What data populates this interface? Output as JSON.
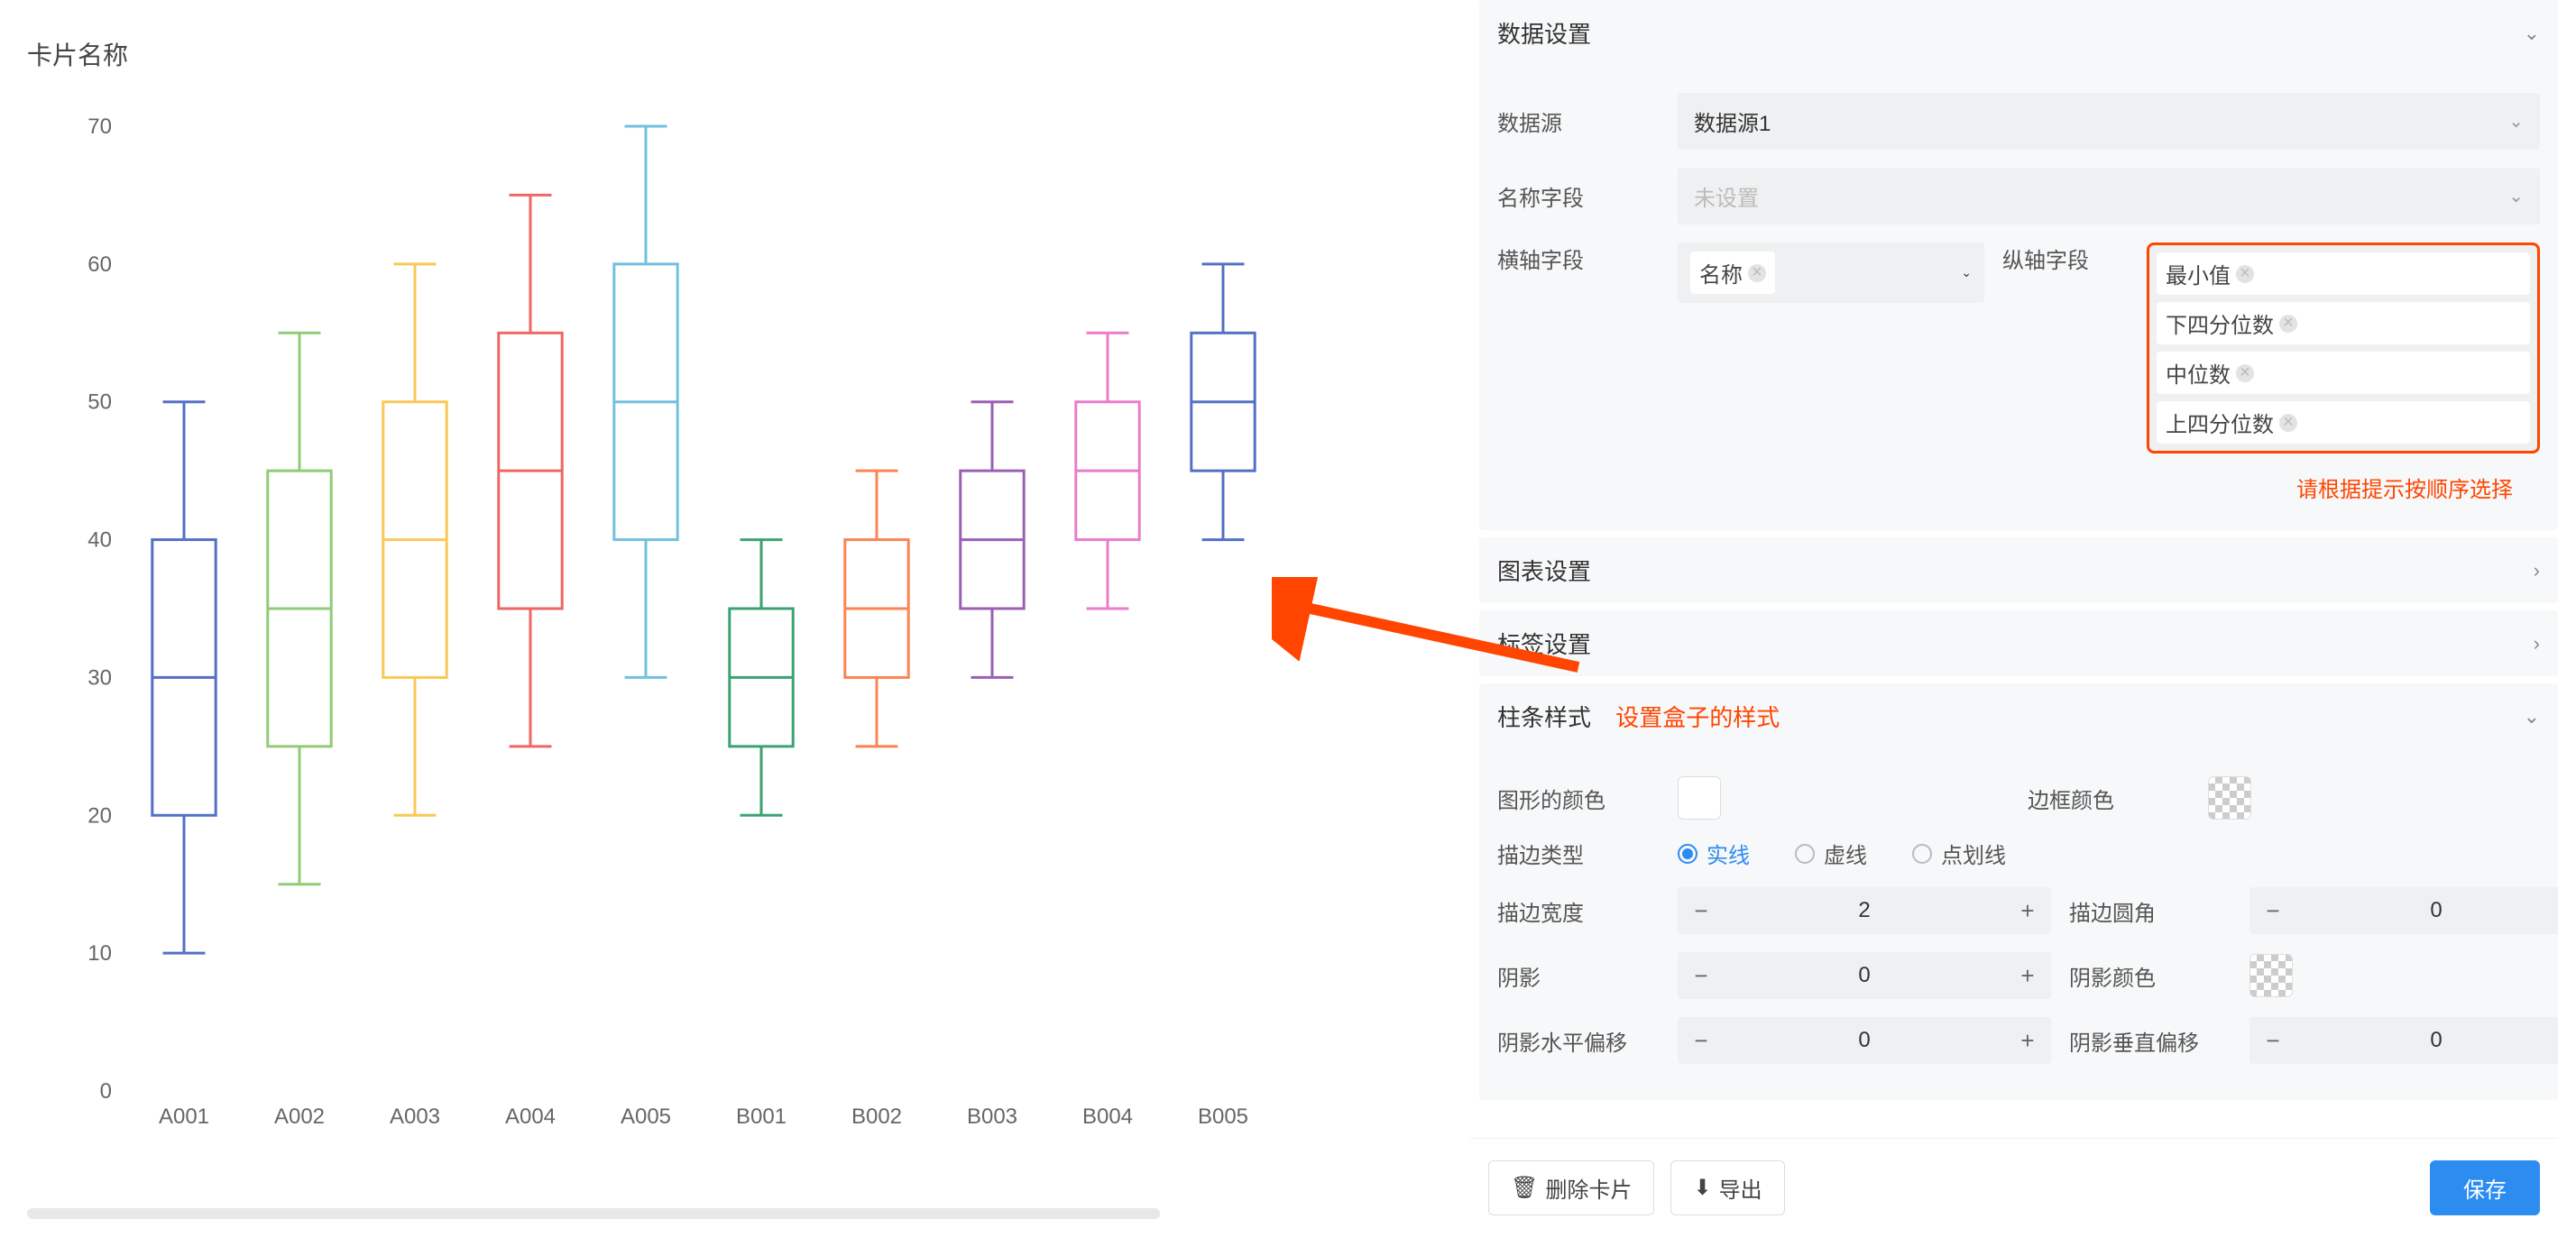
{
  "card_title": "卡片名称",
  "panels": {
    "data": {
      "title": "数据设置",
      "open": true
    },
    "chart": {
      "title": "图表设置",
      "open": false
    },
    "label": {
      "title": "标签设置",
      "open": false
    },
    "bar": {
      "title": "柱条样式",
      "note": "设置盒子的样式",
      "open": true
    }
  },
  "data_settings": {
    "source_label": "数据源",
    "source_value": "数据源1",
    "name_field_label": "名称字段",
    "name_field_placeholder": "未设置",
    "xaxis_label": "横轴字段",
    "xaxis_tag": "名称",
    "yaxis_label": "纵轴字段",
    "yaxis_tags": [
      "最小值",
      "下四分位数",
      "中位数",
      "上四分位数"
    ],
    "order_note": "请根据提示按顺序选择"
  },
  "bar_style": {
    "fill_color_label": "图形的颜色",
    "border_color_label": "边框颜色",
    "stroke_type_label": "描边类型",
    "stroke_types": [
      "实线",
      "虚线",
      "点划线"
    ],
    "stroke_type_selected": "实线",
    "stroke_width_label": "描边宽度",
    "stroke_width": 2,
    "stroke_radius_label": "描边圆角",
    "stroke_radius": 0,
    "shadow_label": "阴影",
    "shadow": 0,
    "shadow_color_label": "阴影颜色",
    "shadow_offx_label": "阴影水平偏移",
    "shadow_offx": 0,
    "shadow_offy_label": "阴影垂直偏移",
    "shadow_offy": 0
  },
  "footer": {
    "delete": "删除卡片",
    "export": "导出",
    "save": "保存"
  },
  "chart_data": {
    "type": "boxplot",
    "title": "",
    "xlabel": "",
    "ylabel": "",
    "ylim": [
      0,
      70
    ],
    "yticks": [
      0,
      10,
      20,
      30,
      40,
      50,
      60,
      70
    ],
    "categories": [
      "A001",
      "A002",
      "A003",
      "A004",
      "A005",
      "B001",
      "B002",
      "B003",
      "B004",
      "B005"
    ],
    "series": [
      {
        "name": "A001",
        "color": "#5470c6",
        "min": 10,
        "q1": 20,
        "median": 30,
        "q3": 40,
        "max": 50
      },
      {
        "name": "A002",
        "color": "#91cc75",
        "min": 15,
        "q1": 25,
        "median": 35,
        "q3": 45,
        "max": 55
      },
      {
        "name": "A003",
        "color": "#fac858",
        "min": 20,
        "q1": 30,
        "median": 40,
        "q3": 50,
        "max": 60
      },
      {
        "name": "A004",
        "color": "#ee6666",
        "min": 25,
        "q1": 35,
        "median": 45,
        "q3": 55,
        "max": 65
      },
      {
        "name": "A005",
        "color": "#73c0de",
        "min": 30,
        "q1": 40,
        "median": 50,
        "q3": 60,
        "max": 70
      },
      {
        "name": "B001",
        "color": "#3ba272",
        "min": 20,
        "q1": 25,
        "median": 30,
        "q3": 35,
        "max": 40
      },
      {
        "name": "B002",
        "color": "#fc8452",
        "min": 25,
        "q1": 30,
        "median": 35,
        "q3": 40,
        "max": 45
      },
      {
        "name": "B003",
        "color": "#9a60b4",
        "min": 30,
        "q1": 35,
        "median": 40,
        "q3": 45,
        "max": 50
      },
      {
        "name": "B004",
        "color": "#ea7ccc",
        "min": 35,
        "q1": 40,
        "median": 45,
        "q3": 50,
        "max": 55
      },
      {
        "name": "B005",
        "color": "#5470c6",
        "min": 40,
        "q1": 45,
        "median": 50,
        "q3": 55,
        "max": 60
      }
    ]
  }
}
